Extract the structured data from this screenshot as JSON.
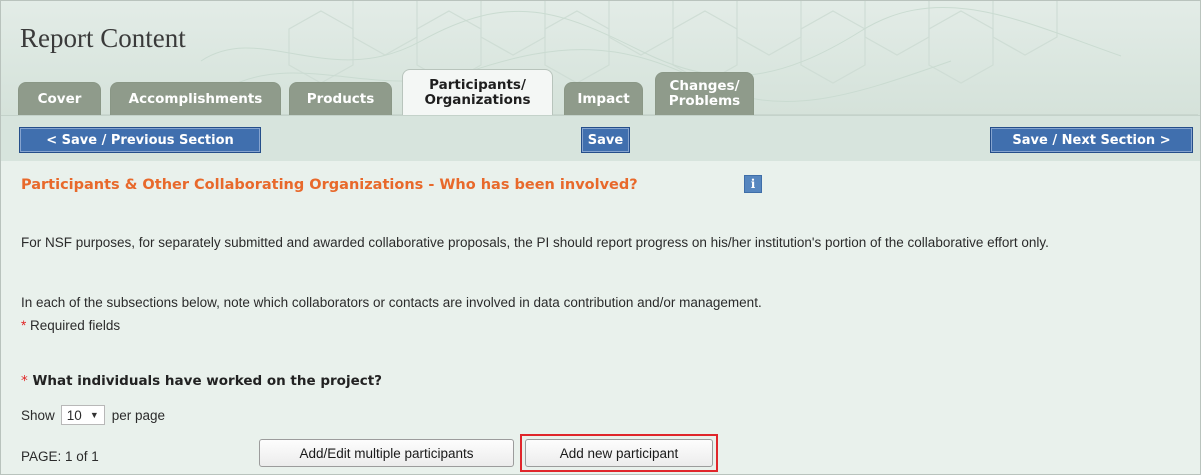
{
  "header": {
    "title": "Report Content"
  },
  "tabs": [
    {
      "line1": "Cover",
      "line2": ""
    },
    {
      "line1": "Accomplishments",
      "line2": ""
    },
    {
      "line1": "Products",
      "line2": ""
    },
    {
      "line1": "Participants/",
      "line2": "Organizations",
      "active": true
    },
    {
      "line1": "Impact",
      "line2": ""
    },
    {
      "line1": "Changes/",
      "line2": "Problems"
    }
  ],
  "navbar": {
    "prev_label": "< Save / Previous Section",
    "save_label": "Save",
    "next_label": "Save / Next Section >"
  },
  "section": {
    "title": "Participants & Other Collaborating Organizations - Who has been involved?",
    "info_icon_glyph": "i",
    "para1": "For NSF purposes, for separately submitted and awarded collaborative proposals, the PI should report progress on his/her institution's portion of the collaborative effort only.",
    "para2": "In each of the subsections below, note which collaborators or contacts are involved in data contribution and/or management.",
    "required_mark": "*",
    "required_label": "Required fields"
  },
  "participants": {
    "question_mark": "*",
    "question": "What individuals have worked on the project?",
    "show_label": "Show",
    "per_page_value": "10",
    "per_page_label": "per page",
    "page_label": "PAGE: 1 of 1",
    "add_edit_multiple_label": "Add/Edit multiple participants",
    "add_new_label": "Add new participant"
  },
  "colors": {
    "accent_orange": "#e8692b",
    "button_blue": "#406fae",
    "tab_grey": "#8f9b8b",
    "highlight_red": "#e0262b"
  }
}
